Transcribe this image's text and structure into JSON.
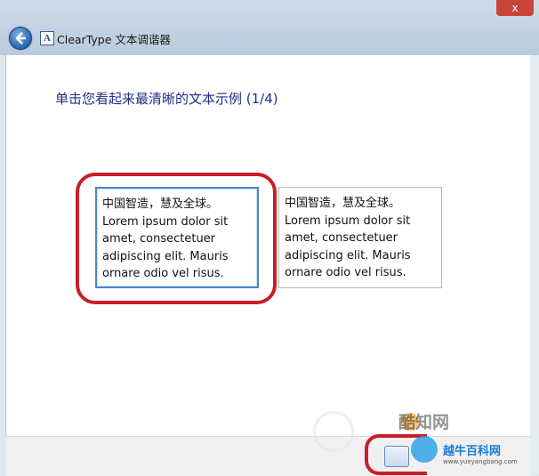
{
  "window": {
    "title": "ClearType 文本调谐器",
    "icon": "app-icon-letter-A",
    "close_label": "x"
  },
  "main": {
    "heading": "单击您看起来最清晰的文本示例 (1/4)",
    "samples": [
      {
        "lines": [
          "中国智造，慧及全球。",
          "Lorem ipsum dolor sit",
          "amet, consectetuer",
          "adipiscing elit. Mauris",
          "ornare odio vel risus."
        ],
        "selected": true
      },
      {
        "lines": [
          "中国智造，慧及全球。",
          "Lorem ipsum dolor sit",
          "amet, consectetuer",
          "adipiscing elit. Mauris",
          "ornare odio vel risus."
        ],
        "selected": false
      }
    ]
  },
  "watermarks": {
    "site1": "酷知网",
    "site2": "越牛百科网",
    "site2_url": "www.yueyangbang.com"
  },
  "colors": {
    "heading": "#1e3287",
    "highlight_ring": "#c81e28",
    "selected_border": "#4b87c5"
  }
}
